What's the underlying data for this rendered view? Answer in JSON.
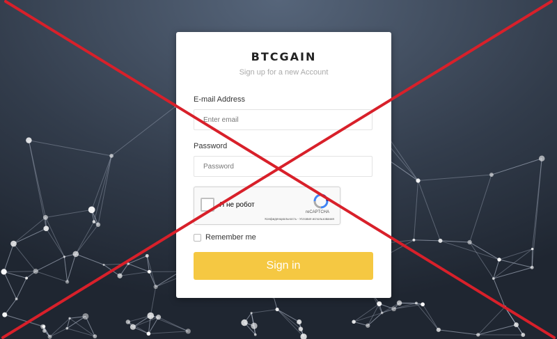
{
  "brand": "BTCGAIN",
  "subtitle": "Sign up for a new Account",
  "email": {
    "label": "E-mail Address",
    "placeholder": "Enter email",
    "value": ""
  },
  "password": {
    "label": "Password",
    "placeholder": "Password",
    "value": ""
  },
  "recaptcha": {
    "checkbox_label": "Я не робот",
    "brand": "reCAPTCHA",
    "terms": "Конфиденциальность - Условия использования"
  },
  "remember_me": {
    "label": "Remember me",
    "checked": false
  },
  "signin_button": "Sign in",
  "colors": {
    "accent": "#f5c842",
    "cross": "#d8202a",
    "background": "#2b3442"
  },
  "icons": [
    "recaptcha-logo-icon",
    "cross-overlay-icon"
  ]
}
